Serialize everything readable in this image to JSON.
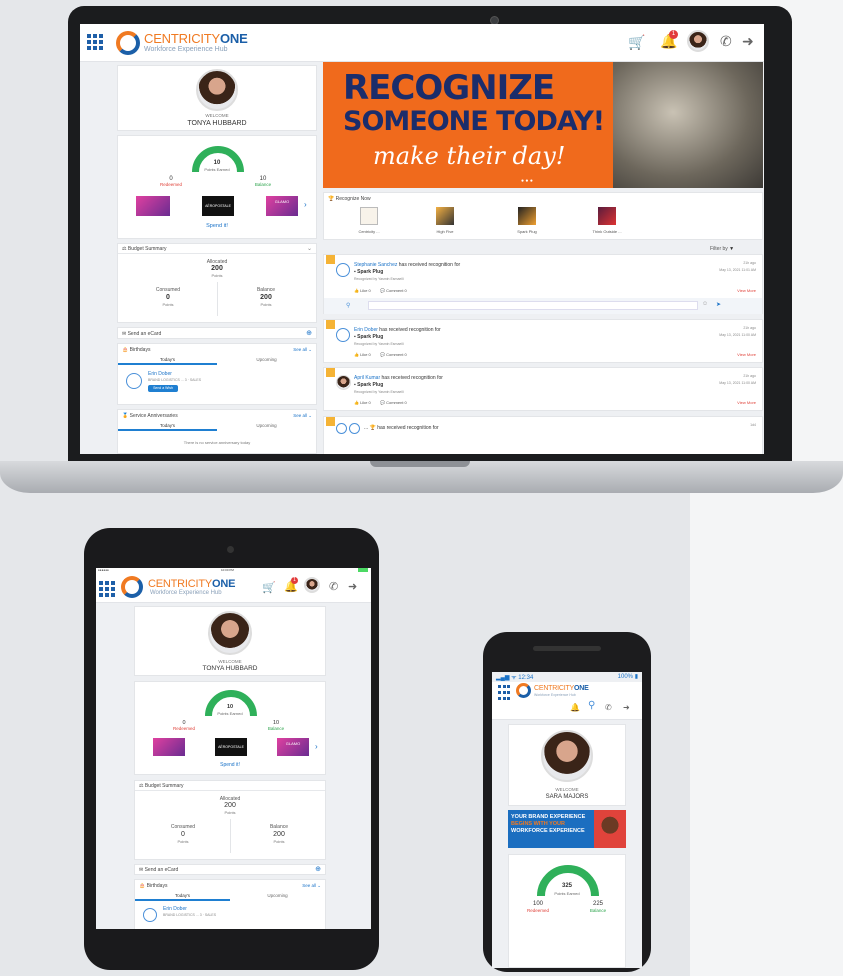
{
  "brand": {
    "name_part1": "CENTRICITY",
    "name_part2": "ONE",
    "tagline": "Workforce Experience Hub"
  },
  "header": {
    "notification_count": "1"
  },
  "profile": {
    "welcome": "WELCOME",
    "name": "TONYA HUBBARD"
  },
  "points": {
    "earned": "10",
    "earned_label": "Points Earned",
    "redeemed": "0",
    "redeemed_label": "Redeemed",
    "balance": "10",
    "balance_label": "Balance",
    "spend_label": "Spend it!",
    "reward_label": "AÉROPOSTALE",
    "reward2_label": "GLAMO"
  },
  "budget": {
    "title": "Budget Summary",
    "allocated_label": "Allocated",
    "allocated": "200",
    "allocated_unit": "Points",
    "consumed_label": "Consumed",
    "consumed": "0",
    "consumed_unit": "Points",
    "balance_label": "Balance",
    "balance": "200",
    "balance_unit": "Points"
  },
  "ecard": {
    "title": "Send an eCard"
  },
  "birthdays": {
    "title": "Birthdays",
    "see_all": "See all ⌄",
    "tab_today": "Today's",
    "tab_upcoming": "Upcoming",
    "person": "Erin Dober",
    "person_detail": "BRAND LOGISTICS ... 3 · SALES",
    "wish_btn": "Send a Wish"
  },
  "anniversaries": {
    "title": "Service Anniversaries",
    "see_all": "See all ⌄",
    "tab_today": "Today's",
    "tab_upcoming": "Upcoming",
    "empty": "There is no service anniversary today"
  },
  "banner": {
    "line1": "RECOGNIZE",
    "line2": "SOMEONE TODAY!",
    "line3": "make their day!"
  },
  "recognize": {
    "title": "Recognize Now",
    "badges": [
      "Centricity ...",
      "High Five",
      "Spark Plug",
      "Think Outside ..."
    ],
    "filter": "Filter by"
  },
  "feed": [
    {
      "name": "Stephanie Sanchez",
      "text": "has received recognition for",
      "award": "Spark Plug",
      "by": "Recognized by Yasmin Esmaeili",
      "time": "21h ago",
      "date": "May 13, 2021 11:01 AM",
      "like": "Like 0",
      "comment": "Comment 0",
      "more": "View More"
    },
    {
      "name": "Erin Dober",
      "text": "has received recognition for",
      "award": "Spark Plug",
      "by": "Recognized by Yasmin Esmaeili",
      "time": "21h ago",
      "date": "May 13, 2021 11:00 AM",
      "like": "Like 0",
      "comment": "Comment 0",
      "more": "View More"
    },
    {
      "name": "April Kumar",
      "text": "has received recognition for",
      "award": "Spark Plug",
      "by": "Recognized by Yasmin Esmaeili",
      "time": "21h ago",
      "date": "May 13, 2021 11:00 AM",
      "like": "Like 0",
      "comment": "Comment 0",
      "more": "View More"
    },
    {
      "name": "... ",
      "text": "has received recognition for",
      "time": "1d4"
    }
  ],
  "tablet": {
    "status_left": "●●●●●●",
    "status_time": "10:00 PM",
    "welcome": "WELCOME",
    "name": "TONYA HUBBARD",
    "earned": "10",
    "earned_label": "Points Earned",
    "redeemed": "0",
    "redeemed_label": "Redeemed",
    "balance": "10",
    "balance_label": "Balance",
    "spend_label": "Spend it!",
    "budget_title": "Budget Summary",
    "allocated_label": "Allocated",
    "allocated": "200",
    "allocated_unit": "Points",
    "consumed_label": "Consumed",
    "consumed": "0",
    "consumed_unit": "Points",
    "bal_label": "Balance",
    "bal": "200",
    "bal_unit": "Points",
    "ecard": "Send an eCard",
    "birthdays": "Birthdays",
    "see_all": "See all ⌄",
    "tab_today": "Today's",
    "tab_upcoming": "Upcoming",
    "person": "Erin Dober",
    "person_detail": "BRAND LOGISTICS ... 3 · SALES"
  },
  "phone": {
    "status_time": "12:34",
    "battery": "100%",
    "welcome": "WELCOME",
    "name": "SARA MAJORS",
    "banner_line1": "YOUR BRAND EXPERIENCE",
    "banner_line2": "BEGINS WITH YOUR",
    "banner_line3": "WORKFORCE EXPERIENCE",
    "earned": "325",
    "earned_label": "Points Earned",
    "redeemed": "100",
    "redeemed_label": "Redeemed",
    "balance": "225",
    "balance_label": "Balance"
  },
  "colors": {
    "orange": "#f06a1c",
    "blue": "#1b5fa8",
    "green": "#2fb05a",
    "red": "#e0433b"
  }
}
